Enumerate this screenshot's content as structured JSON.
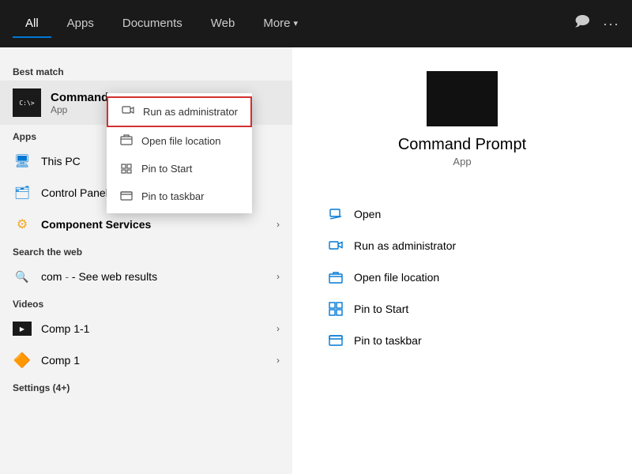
{
  "header": {
    "tabs": [
      {
        "label": "All",
        "active": true
      },
      {
        "label": "Apps",
        "active": false
      },
      {
        "label": "Documents",
        "active": false
      },
      {
        "label": "Web",
        "active": false
      },
      {
        "label": "More",
        "active": false,
        "has_arrow": true
      }
    ],
    "icons": {
      "feedback": "🗨",
      "more": "···"
    }
  },
  "left": {
    "best_match_label": "Best match",
    "best_match": {
      "name": "Command Prompt",
      "type": "App"
    },
    "context_menu": {
      "items": [
        {
          "label": "Run as administrator",
          "highlighted": true
        },
        {
          "label": "Open file location"
        },
        {
          "label": "Pin to Start"
        },
        {
          "label": "Pin to taskbar"
        }
      ]
    },
    "apps_label": "Apps",
    "apps": [
      {
        "label": "This PC",
        "bold": false
      },
      {
        "label": "Control Panel",
        "bold": false
      },
      {
        "label": "Component Services",
        "bold": true,
        "has_arrow": true
      }
    ],
    "web_label": "Search the web",
    "web_items": [
      {
        "label": "com",
        "suffix": "- See web results",
        "has_arrow": true
      }
    ],
    "videos_label": "Videos",
    "videos": [
      {
        "label": "Comp 1-1",
        "has_arrow": true
      },
      {
        "label": "Comp 1",
        "has_arrow": true
      }
    ],
    "settings_label": "Settings (4+)"
  },
  "right": {
    "app_name": "Command Prompt",
    "app_type": "App",
    "actions": [
      {
        "label": "Open"
      },
      {
        "label": "Run as administrator"
      },
      {
        "label": "Open file location"
      },
      {
        "label": "Pin to Start"
      },
      {
        "label": "Pin to taskbar"
      }
    ]
  }
}
